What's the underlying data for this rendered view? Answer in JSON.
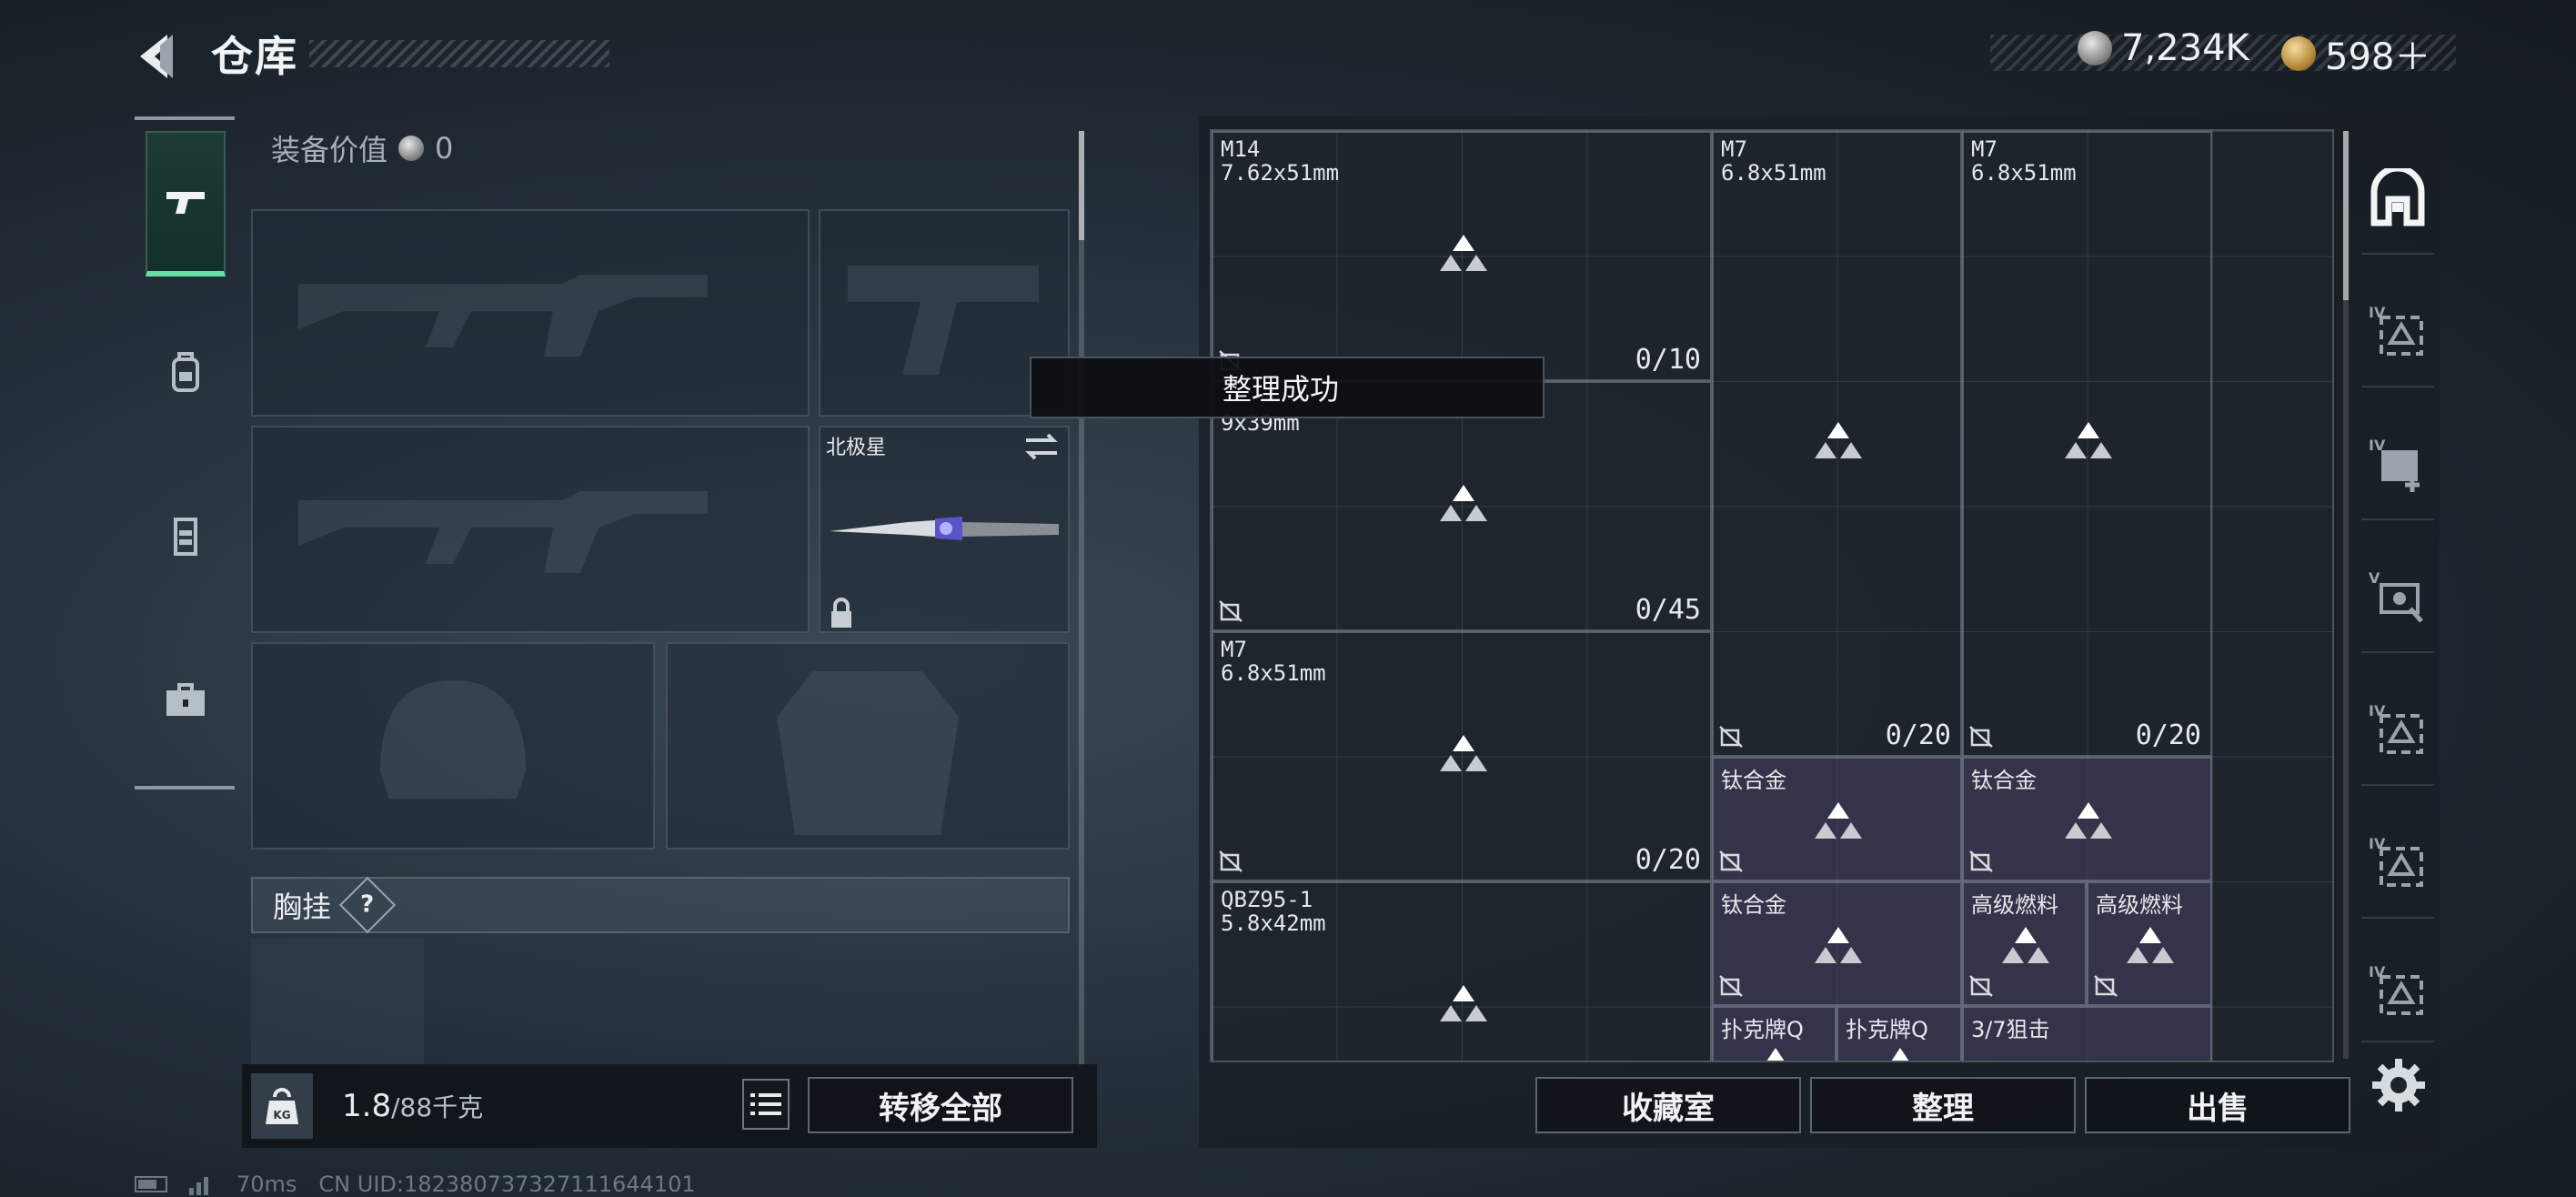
{
  "header": {
    "title": "仓库",
    "currencies": [
      {
        "icon": "silver-coin-icon",
        "amount": "7,234K"
      },
      {
        "icon": "gold-coin-icon",
        "amount": "598＋"
      }
    ]
  },
  "left_rail": {
    "tabs": [
      {
        "name": "pistol-icon",
        "active": true
      },
      {
        "name": "backpack-icon",
        "active": false
      },
      {
        "name": "vest-icon",
        "active": false
      },
      {
        "name": "toolbox-icon",
        "active": false
      }
    ]
  },
  "equipment": {
    "value_label": "装备价值",
    "value": "0",
    "knife_name": "北极星",
    "chest_label": "胸挂",
    "chest_help": "?"
  },
  "bottom_left": {
    "weight_current": "1.8",
    "weight_max": "/88千克",
    "transfer_all": "转移全部"
  },
  "status": {
    "ping": "70ms",
    "uid": "CN UID:18238073732711164410​1"
  },
  "toast": "整理成功",
  "storage": {
    "items": [
      {
        "name": "M14",
        "caliber": "7.62x51mm",
        "count": "0/10"
      },
      {
        "name": "",
        "caliber": "9x39mm",
        "count": "0/45"
      },
      {
        "name": "M7",
        "caliber": "6.8x51mm",
        "count": "0/20"
      },
      {
        "name": "QBZ95-1",
        "caliber": "5.8x42mm",
        "count": ""
      },
      {
        "name": "M7",
        "caliber": "6.8x51mm",
        "count": "0/20"
      },
      {
        "name": "M7",
        "caliber": "6.8x51mm",
        "count": "0/20"
      }
    ],
    "materials": [
      {
        "name": "钛合金"
      },
      {
        "name": "钛合金"
      },
      {
        "name": "钛合金"
      },
      {
        "name": "高级燃料"
      },
      {
        "name": "高级燃料"
      },
      {
        "name": "扑克牌Q"
      },
      {
        "name": "扑克牌Q"
      },
      {
        "name": "3/7狙击"
      }
    ]
  },
  "buttons": {
    "collection": "收藏室",
    "sort": "整理",
    "sell": "出售"
  },
  "right_rail": {
    "labels": [
      "IV",
      "IV",
      "V",
      "IV",
      "IV",
      "IV"
    ]
  }
}
